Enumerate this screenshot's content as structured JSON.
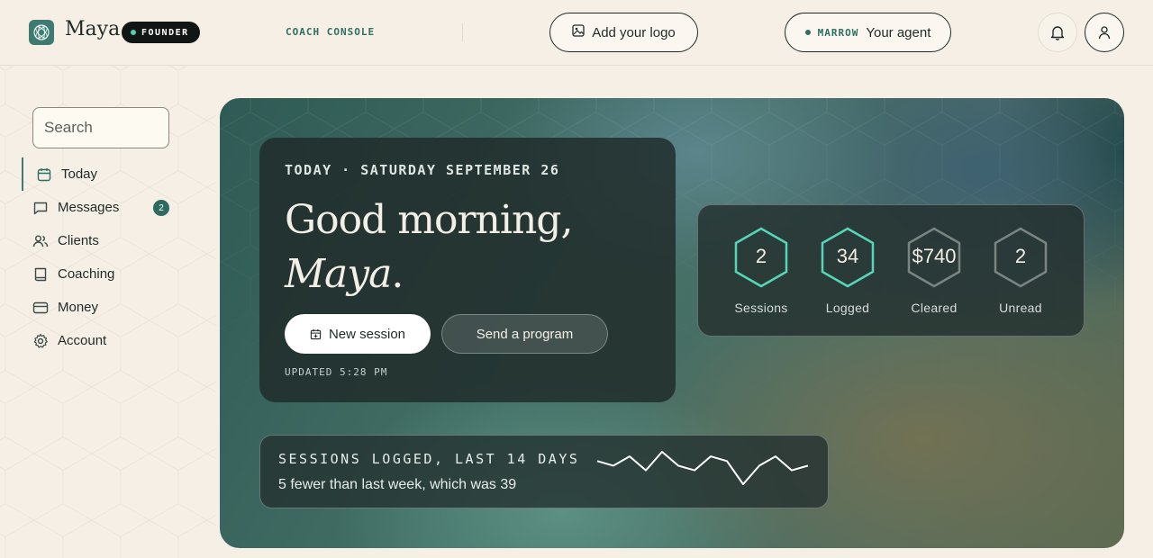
{
  "brand": {
    "name": "Maya",
    "badge": "FOUNDER"
  },
  "header": {
    "console_label": "COACH CONSOLE",
    "logo_button": "Add your logo",
    "agent_button": {
      "tag": "MARROW",
      "label": "Your agent"
    }
  },
  "sidebar": {
    "search_placeholder": "Search",
    "items": [
      {
        "label": "Today",
        "icon": "calendar-icon",
        "active": true
      },
      {
        "label": "Messages",
        "icon": "message-icon",
        "badge": "2"
      },
      {
        "label": "Clients",
        "icon": "users-icon"
      },
      {
        "label": "Coaching",
        "icon": "book-icon"
      },
      {
        "label": "Money",
        "icon": "card-icon"
      },
      {
        "label": "Account",
        "icon": "gear-icon"
      }
    ]
  },
  "hero": {
    "date_line": "TODAY · SATURDAY SEPTEMBER 26",
    "greeting": "Good morning,",
    "name": "Maya",
    "period": ".",
    "new_session": "New session",
    "send_program": "Send a program",
    "updated": "UPDATED 5:28 PM"
  },
  "stats": [
    {
      "value": "2",
      "label": "Sessions",
      "color": "#56d6b8"
    },
    {
      "value": "34",
      "label": "Logged",
      "color": "#56d6b8"
    },
    {
      "value": "$740",
      "label": "Cleared",
      "color": "#7a8582"
    },
    {
      "value": "2",
      "label": "Unread",
      "color": "#7a8582"
    }
  ],
  "trend": {
    "title": "SESSIONS LOGGED, LAST 14 DAYS",
    "subtitle": "5 fewer than last week, which was 39",
    "values": [
      3,
      2,
      4,
      1,
      5,
      2,
      1,
      4,
      3,
      -2,
      2,
      4,
      1,
      2
    ]
  },
  "colors": {
    "accent": "#3f7a72",
    "teal": "#56d6b8",
    "background": "#f5efe6"
  }
}
